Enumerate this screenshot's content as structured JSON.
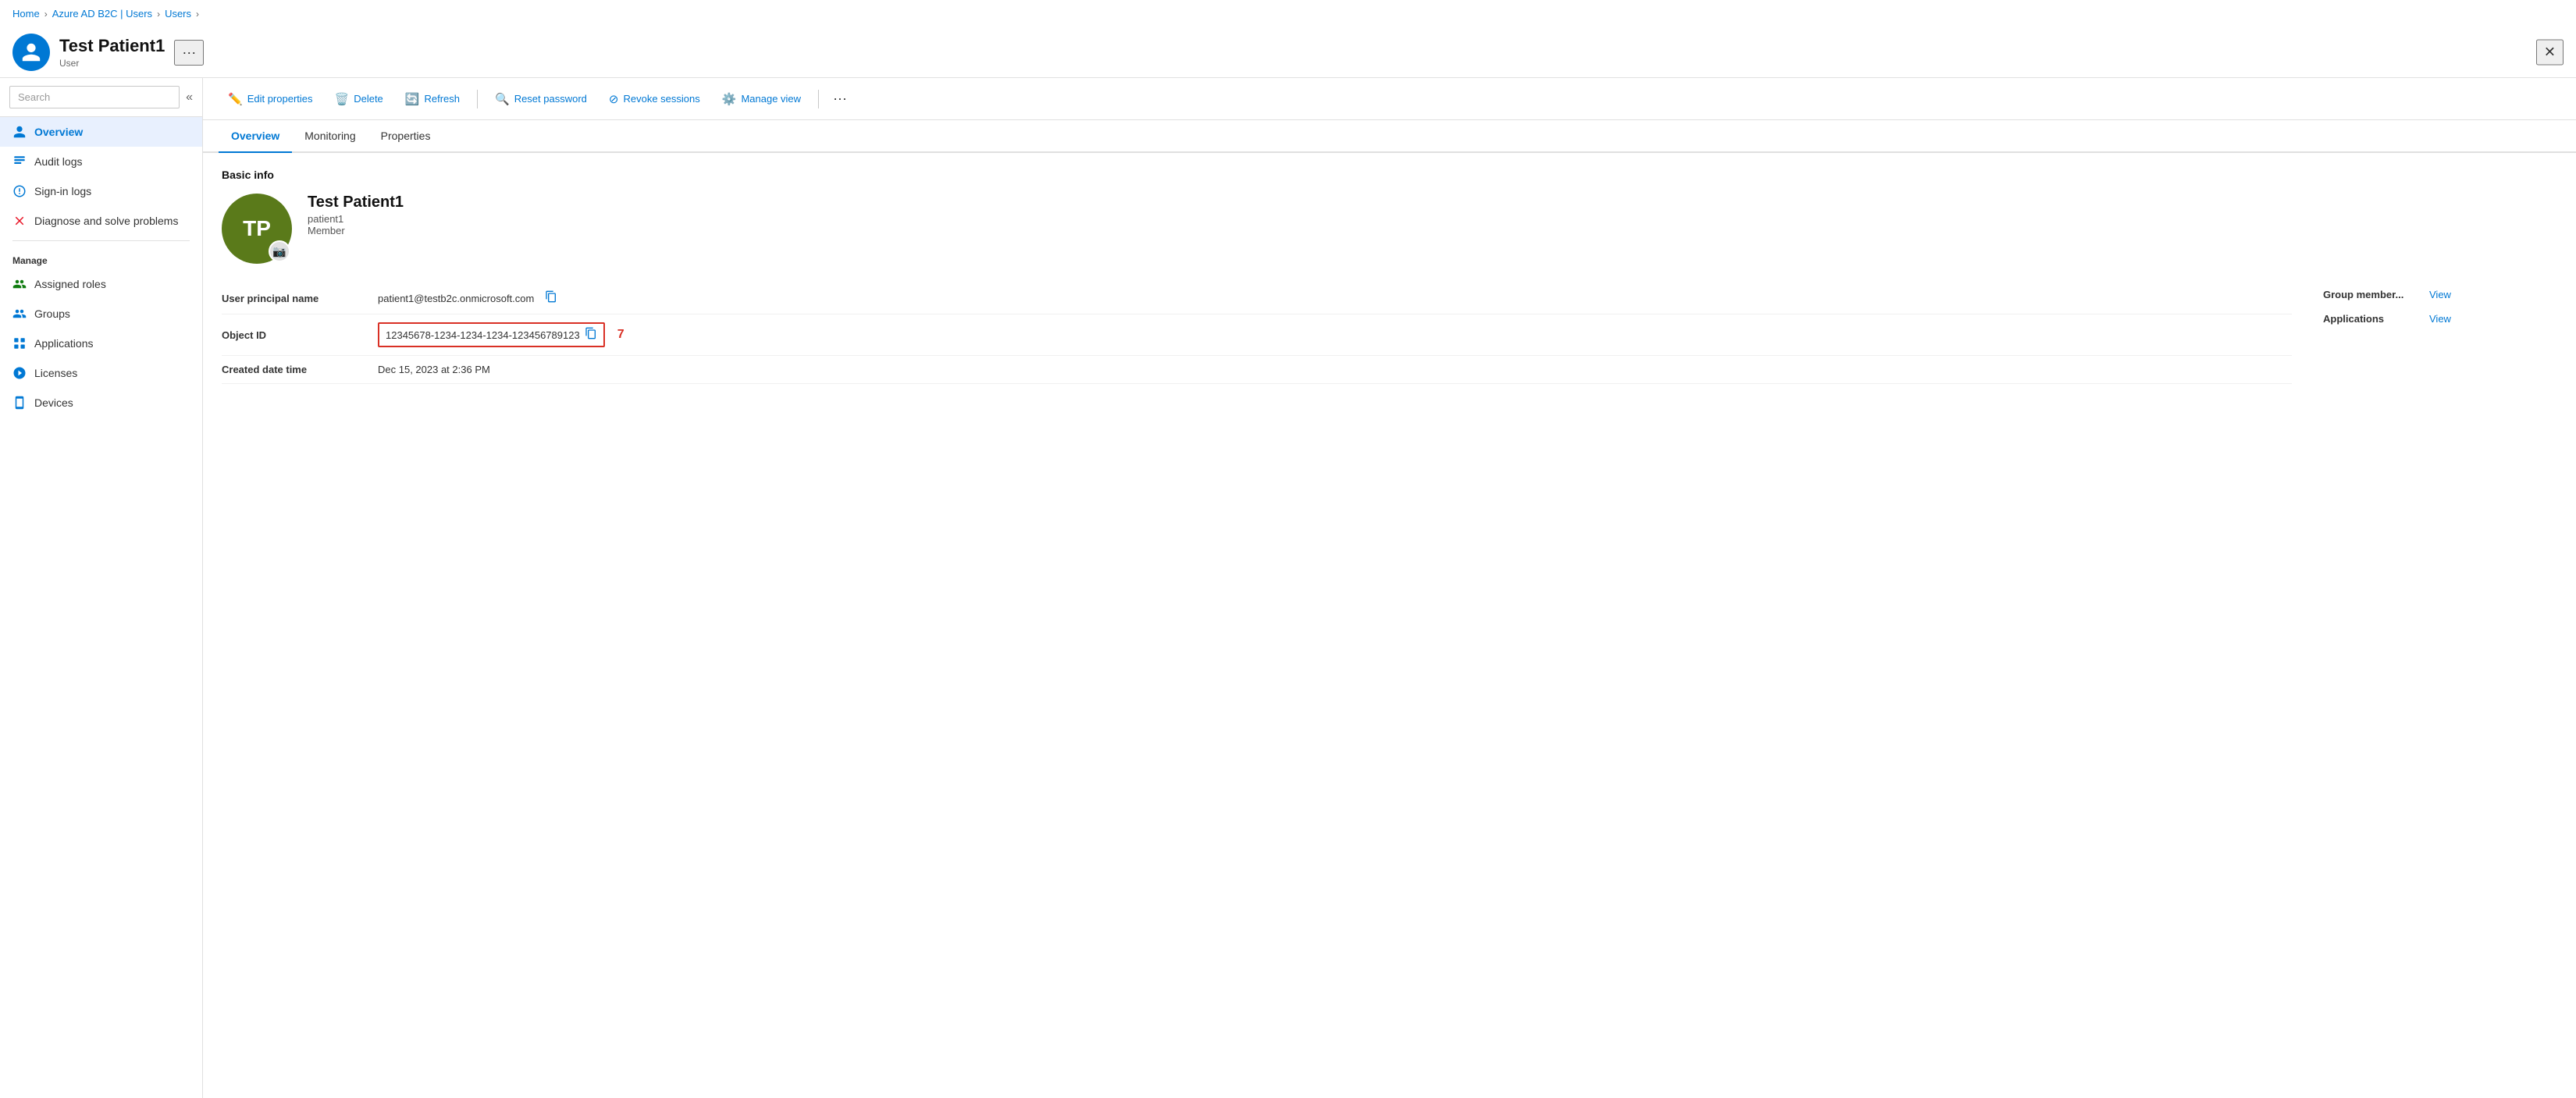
{
  "breadcrumb": {
    "items": [
      "Home",
      "Azure AD B2C | Users",
      "Users"
    ]
  },
  "header": {
    "title": "Test Patient1",
    "subtitle": "User",
    "more_label": "···",
    "close_label": "✕",
    "avatar_initials": "TP"
  },
  "sidebar": {
    "search_placeholder": "Search",
    "collapse_icon": "«",
    "nav_items": [
      {
        "id": "overview",
        "label": "Overview",
        "active": true
      },
      {
        "id": "audit-logs",
        "label": "Audit logs",
        "active": false
      },
      {
        "id": "sign-in-logs",
        "label": "Sign-in logs",
        "active": false
      },
      {
        "id": "diagnose",
        "label": "Diagnose and solve problems",
        "active": false
      }
    ],
    "manage_label": "Manage",
    "manage_items": [
      {
        "id": "assigned-roles",
        "label": "Assigned roles",
        "active": false
      },
      {
        "id": "groups",
        "label": "Groups",
        "active": false
      },
      {
        "id": "applications",
        "label": "Applications",
        "active": false
      },
      {
        "id": "licenses",
        "label": "Licenses",
        "active": false
      },
      {
        "id": "devices",
        "label": "Devices",
        "active": false
      }
    ]
  },
  "toolbar": {
    "buttons": [
      {
        "id": "edit-properties",
        "icon": "✏️",
        "label": "Edit properties"
      },
      {
        "id": "delete",
        "icon": "🗑️",
        "label": "Delete"
      },
      {
        "id": "refresh",
        "icon": "🔄",
        "label": "Refresh"
      },
      {
        "id": "reset-password",
        "icon": "🔍",
        "label": "Reset password"
      },
      {
        "id": "revoke-sessions",
        "icon": "⊘",
        "label": "Revoke sessions"
      },
      {
        "id": "manage-view",
        "icon": "⚙️",
        "label": "Manage view"
      }
    ],
    "more_label": "···"
  },
  "tabs": {
    "items": [
      {
        "id": "overview",
        "label": "Overview",
        "active": true
      },
      {
        "id": "monitoring",
        "label": "Monitoring",
        "active": false
      },
      {
        "id": "properties",
        "label": "Properties",
        "active": false
      }
    ]
  },
  "content": {
    "section_title": "Basic info",
    "user_avatar_initials": "TP",
    "user_name": "Test Patient1",
    "user_handle": "patient1",
    "user_role": "Member",
    "fields": [
      {
        "id": "upn",
        "label": "User principal name",
        "value": "patient1@testb2c.onmicrosoft.com",
        "copyable": true,
        "highlighted": false
      },
      {
        "id": "object-id",
        "label": "Object ID",
        "value": "12345678-1234-1234-1234-123456789123",
        "copyable": true,
        "highlighted": true
      },
      {
        "id": "created-date",
        "label": "Created date time",
        "value": "Dec 15, 2023 at 2:36 PM",
        "copyable": false,
        "highlighted": false
      }
    ],
    "highlight_number": "7",
    "right_panel": [
      {
        "id": "group-member",
        "label": "Group member...",
        "link_text": "View"
      },
      {
        "id": "applications-right",
        "label": "Applications",
        "link_text": "View"
      }
    ]
  }
}
